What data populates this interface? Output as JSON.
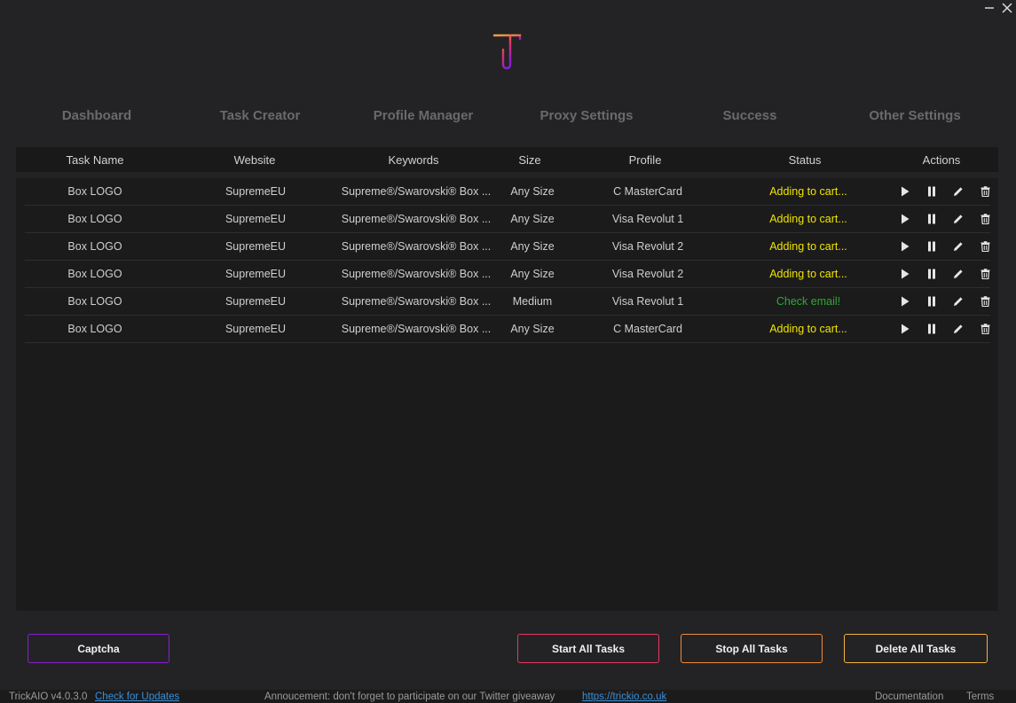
{
  "window": {
    "controls": [
      "minimize-icon",
      "close-icon"
    ]
  },
  "logo": {
    "icon": "trickaio-logo",
    "colors": [
      "#f7b23b",
      "#e8385f",
      "#8a1fd0"
    ]
  },
  "nav": {
    "items": [
      {
        "label": "Dashboard"
      },
      {
        "label": "Task Creator"
      },
      {
        "label": "Profile Manager"
      },
      {
        "label": "Proxy Settings"
      },
      {
        "label": "Success"
      },
      {
        "label": "Other Settings"
      }
    ]
  },
  "table": {
    "columns": [
      "Task Name",
      "Website",
      "Keywords",
      "Size",
      "Profile",
      "Status",
      "Actions"
    ],
    "action_icons": [
      "play-icon",
      "pause-icon",
      "edit-icon",
      "trash-icon"
    ],
    "rows": [
      {
        "task_name": "Box LOGO",
        "website": "SupremeEU",
        "keywords": "Supreme®/Swarovski® Box ...",
        "size": "Any Size",
        "profile": "C MasterCard",
        "status": "Adding to cart...",
        "status_type": "warn"
      },
      {
        "task_name": "Box LOGO",
        "website": "SupremeEU",
        "keywords": "Supreme®/Swarovski® Box ...",
        "size": "Any Size",
        "profile": "Visa Revolut 1",
        "status": "Adding to cart...",
        "status_type": "warn"
      },
      {
        "task_name": "Box LOGO",
        "website": "SupremeEU",
        "keywords": "Supreme®/Swarovski® Box ...",
        "size": "Any Size",
        "profile": "Visa Revolut 2",
        "status": "Adding to cart...",
        "status_type": "warn"
      },
      {
        "task_name": "Box LOGO",
        "website": "SupremeEU",
        "keywords": "Supreme®/Swarovski® Box ...",
        "size": "Any Size",
        "profile": "Visa Revolut 2",
        "status": "Adding to cart...",
        "status_type": "warn"
      },
      {
        "task_name": "Box LOGO",
        "website": "SupremeEU",
        "keywords": "Supreme®/Swarovski® Box ...",
        "size": "Medium",
        "profile": "Visa Revolut 1",
        "status": "Check email!",
        "status_type": "ok"
      },
      {
        "task_name": "Box LOGO",
        "website": "SupremeEU",
        "keywords": "Supreme®/Swarovski® Box ...",
        "size": "Any Size",
        "profile": "C MasterCard",
        "status": "Adding to cart...",
        "status_type": "warn"
      }
    ]
  },
  "buttons": {
    "captcha": {
      "label": "Captcha",
      "color": "#8a1fd0"
    },
    "start_all": {
      "label": "Start All Tasks",
      "color": "#e8385f"
    },
    "stop_all": {
      "label": "Stop All Tasks",
      "color": "#f08a3a"
    },
    "delete_all": {
      "label": "Delete All Tasks",
      "color": "#f7b23b"
    }
  },
  "colors": {
    "status_warn": "#f2e400",
    "status_ok": "#2fa92f",
    "link": "#3b8fd6"
  },
  "footer": {
    "version": "TrickAIO v4.0.3.0",
    "check_updates": "Check for Updates",
    "announcement": "Annoucement: don't forget to participate on our Twitter giveaway",
    "announcement_link": "https://trickio.co.uk",
    "documentation": "Documentation",
    "terms": "Terms"
  }
}
